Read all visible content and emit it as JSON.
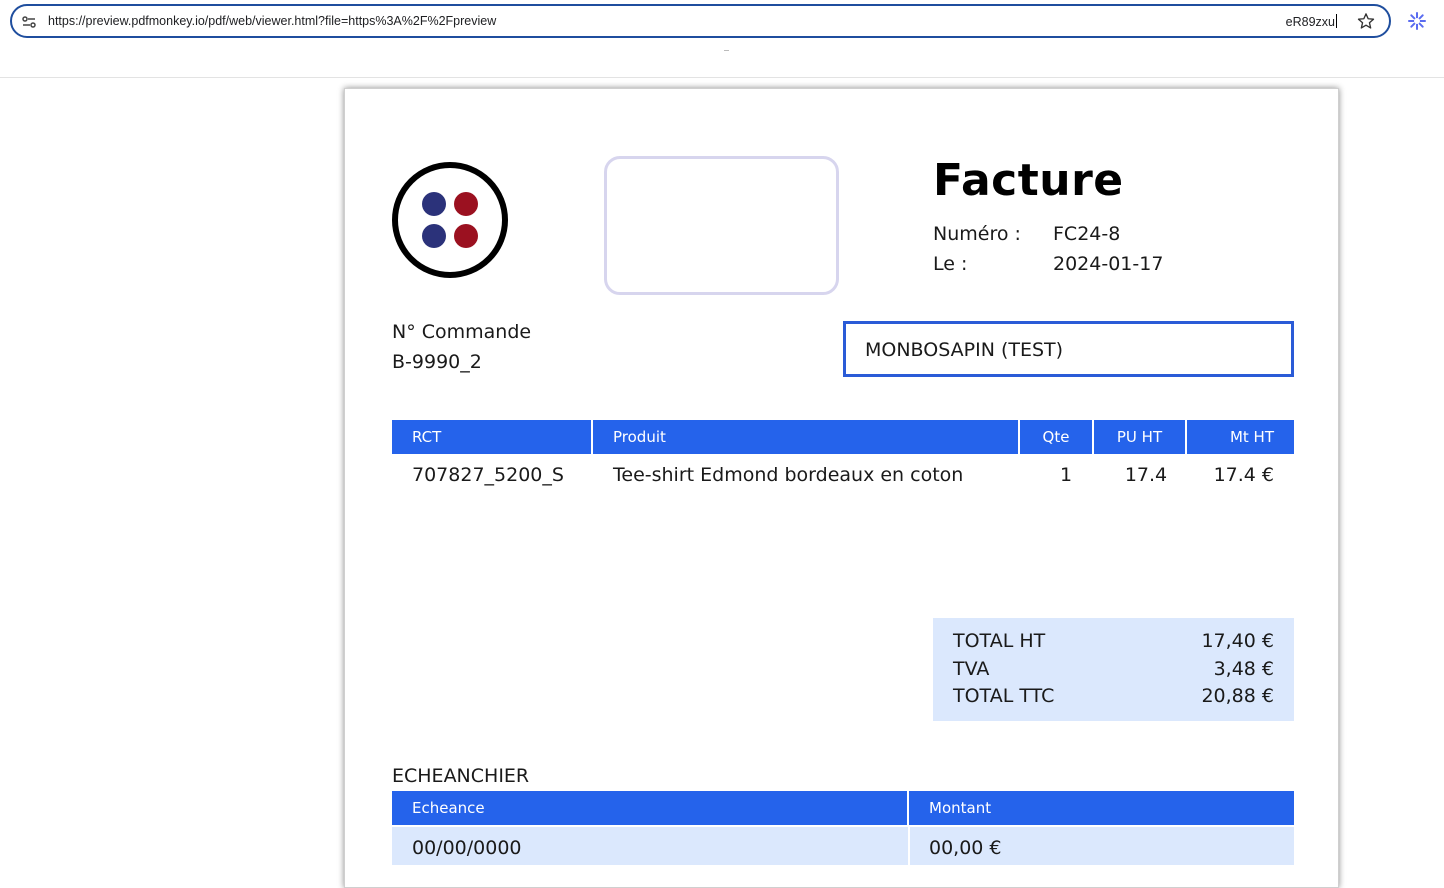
{
  "browser": {
    "url": "https://preview.pdfmonkey.io/pdf/web/viewer.html?file=https%3A%2F%2Fpreview",
    "url_tail": "eR89zxu"
  },
  "invoice": {
    "title": "Facture",
    "number_label": "Numéro :",
    "number": "FC24-8",
    "date_label": "Le :",
    "date": "2024-01-17",
    "order_label": "N° Commande",
    "order_number": "B-9990_2",
    "client": "MONBOSAPIN (TEST)",
    "colors": {
      "accent": "#2563eb",
      "light": "#dbe8fd",
      "logo_blue": "#2b327a",
      "logo_red": "#9b1120"
    }
  },
  "items": {
    "headers": [
      "RCT",
      "Produit",
      "Qte",
      "PU HT",
      "Mt HT"
    ],
    "rows": [
      [
        "707827_5200_S",
        "Tee-shirt Edmond bordeaux en coton",
        "1",
        "17.4",
        "17.4 €"
      ]
    ]
  },
  "totals": {
    "ht_label": "TOTAL HT",
    "ht_value": "17,40 €",
    "tva_label": "TVA",
    "tva_value": "3,48 €",
    "ttc_label": "TOTAL TTC",
    "ttc_value": "20,88 €"
  },
  "schedule": {
    "title": "ECHEANCHIER",
    "headers": [
      "Echeance",
      "Montant"
    ],
    "rows": [
      [
        "00/00/0000",
        "00,00 €"
      ]
    ]
  }
}
